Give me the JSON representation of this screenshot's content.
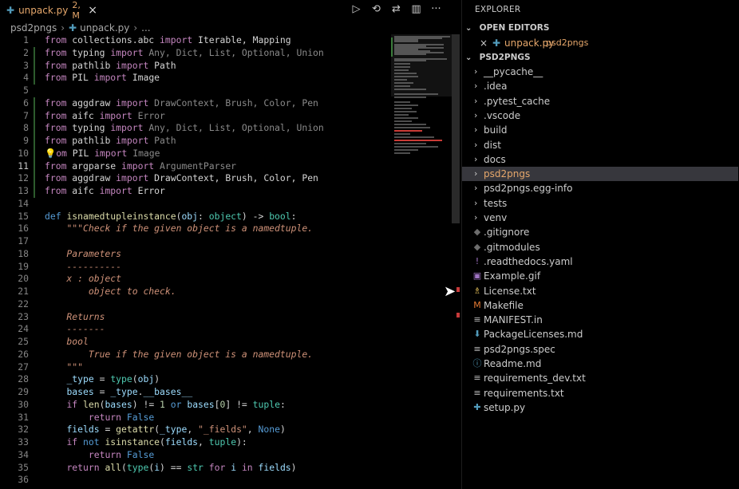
{
  "tab": {
    "filename": "unpack.py",
    "status": "2, M",
    "close": "×"
  },
  "toolbar": {
    "run": "▷",
    "history": "⟲",
    "compare": "⇄",
    "split": "▥",
    "more": "···"
  },
  "breadcrumb": {
    "folder": "psd2pngs",
    "file": "unpack.py",
    "symbol": "..."
  },
  "code_lines": [
    {
      "n": "1",
      "segs": [
        [
          "kw",
          "from"
        ],
        [
          "plain",
          " collections.abc "
        ],
        [
          "kw",
          "import"
        ],
        [
          "plain",
          " Iterable, Mapping"
        ]
      ]
    },
    {
      "n": "2",
      "segs": [
        [
          "kw",
          "from"
        ],
        [
          "plain",
          " typing "
        ],
        [
          "kw",
          "import"
        ],
        [
          "dim",
          " Any, Dict, List, Optional, Union"
        ]
      ]
    },
    {
      "n": "3",
      "segs": [
        [
          "kw",
          "from"
        ],
        [
          "plain",
          " pathlib "
        ],
        [
          "kw",
          "import"
        ],
        [
          "plain",
          " Path"
        ]
      ]
    },
    {
      "n": "4",
      "segs": [
        [
          "kw",
          "from"
        ],
        [
          "plain",
          " PIL "
        ],
        [
          "kw",
          "import"
        ],
        [
          "plain",
          " Image"
        ]
      ]
    },
    {
      "n": "5",
      "segs": []
    },
    {
      "n": "6",
      "segs": [
        [
          "kw",
          "from"
        ],
        [
          "plain",
          " aggdraw "
        ],
        [
          "kw",
          "import"
        ],
        [
          "dim",
          " DrawContext, Brush, Color, Pen"
        ]
      ]
    },
    {
      "n": "7",
      "segs": [
        [
          "kw",
          "from"
        ],
        [
          "plain",
          " aifc "
        ],
        [
          "kw",
          "import"
        ],
        [
          "dim",
          " Error"
        ]
      ]
    },
    {
      "n": "8",
      "segs": [
        [
          "kw",
          "from"
        ],
        [
          "plain",
          " typing "
        ],
        [
          "kw",
          "import"
        ],
        [
          "dim",
          " Any, Dict, List, Optional, Union"
        ]
      ]
    },
    {
      "n": "9",
      "segs": [
        [
          "kw",
          "from"
        ],
        [
          "plain",
          " pathlib "
        ],
        [
          "kw",
          "import"
        ],
        [
          "dim",
          " Path"
        ]
      ]
    },
    {
      "n": "10",
      "segs": [
        [
          "bulb",
          "💡"
        ],
        [
          "kw",
          "om"
        ],
        [
          "plain",
          " PIL "
        ],
        [
          "kw",
          "import"
        ],
        [
          "dim",
          " Image"
        ]
      ]
    },
    {
      "n": "11",
      "segs": [
        [
          "kw",
          "from"
        ],
        [
          "plain",
          " argparse "
        ],
        [
          "kw",
          "import"
        ],
        [
          "dim",
          " ArgumentParser"
        ]
      ]
    },
    {
      "n": "12",
      "segs": [
        [
          "kw",
          "from"
        ],
        [
          "plain",
          " aggdraw "
        ],
        [
          "kw",
          "import"
        ],
        [
          "plain",
          " DrawContext, Brush, Color, Pen"
        ]
      ]
    },
    {
      "n": "13",
      "segs": [
        [
          "kw",
          "from"
        ],
        [
          "plain",
          " aifc "
        ],
        [
          "kw",
          "import"
        ],
        [
          "plain",
          " Error"
        ]
      ]
    },
    {
      "n": "14",
      "segs": []
    },
    {
      "n": "15",
      "segs": [
        [
          "kw2",
          "def"
        ],
        [
          "plain",
          " "
        ],
        [
          "fn",
          "isnamedtupleinstance"
        ],
        [
          "plain",
          "("
        ],
        [
          "var",
          "obj"
        ],
        [
          "plain",
          ": "
        ],
        [
          "ty",
          "object"
        ],
        [
          "plain",
          ") -> "
        ],
        [
          "ty",
          "bool"
        ],
        [
          "plain",
          ":"
        ]
      ]
    },
    {
      "n": "16",
      "segs": [
        [
          "plain",
          "    "
        ],
        [
          "doc",
          "\"\"\"Check if the given object is a namedtuple."
        ]
      ]
    },
    {
      "n": "17",
      "segs": []
    },
    {
      "n": "18",
      "segs": [
        [
          "doc",
          "    Parameters"
        ]
      ]
    },
    {
      "n": "19",
      "segs": [
        [
          "doc",
          "    ----------"
        ]
      ]
    },
    {
      "n": "20",
      "segs": [
        [
          "doc",
          "    x : object"
        ]
      ]
    },
    {
      "n": "21",
      "segs": [
        [
          "doc",
          "        object to check."
        ]
      ]
    },
    {
      "n": "22",
      "segs": []
    },
    {
      "n": "23",
      "segs": [
        [
          "doc",
          "    Returns"
        ]
      ]
    },
    {
      "n": "24",
      "segs": [
        [
          "doc",
          "    -------"
        ]
      ]
    },
    {
      "n": "25",
      "segs": [
        [
          "doc",
          "    bool"
        ]
      ]
    },
    {
      "n": "26",
      "segs": [
        [
          "doc",
          "        True if the given object is a namedtuple."
        ]
      ]
    },
    {
      "n": "27",
      "segs": [
        [
          "doc",
          "    \"\"\""
        ]
      ]
    },
    {
      "n": "28",
      "segs": [
        [
          "plain",
          "    "
        ],
        [
          "var",
          "_type"
        ],
        [
          "plain",
          " = "
        ],
        [
          "ty",
          "type"
        ],
        [
          "plain",
          "("
        ],
        [
          "var",
          "obj"
        ],
        [
          "plain",
          ")"
        ]
      ]
    },
    {
      "n": "29",
      "segs": [
        [
          "plain",
          "    "
        ],
        [
          "var",
          "bases"
        ],
        [
          "plain",
          " = "
        ],
        [
          "var",
          "_type"
        ],
        [
          "plain",
          "."
        ],
        [
          "var",
          "__bases__"
        ]
      ]
    },
    {
      "n": "30",
      "segs": [
        [
          "plain",
          "    "
        ],
        [
          "kw",
          "if"
        ],
        [
          "plain",
          " "
        ],
        [
          "fn",
          "len"
        ],
        [
          "plain",
          "("
        ],
        [
          "var",
          "bases"
        ],
        [
          "plain",
          ") != "
        ],
        [
          "num",
          "1"
        ],
        [
          "plain",
          " "
        ],
        [
          "kw2",
          "or"
        ],
        [
          "plain",
          " "
        ],
        [
          "var",
          "bases"
        ],
        [
          "plain",
          "["
        ],
        [
          "num",
          "0"
        ],
        [
          "plain",
          "] != "
        ],
        [
          "ty",
          "tuple"
        ],
        [
          "plain",
          ":"
        ]
      ]
    },
    {
      "n": "31",
      "segs": [
        [
          "plain",
          "        "
        ],
        [
          "kw",
          "return"
        ],
        [
          "plain",
          " "
        ],
        [
          "kw2",
          "False"
        ]
      ]
    },
    {
      "n": "32",
      "segs": [
        [
          "plain",
          "    "
        ],
        [
          "var",
          "fields"
        ],
        [
          "plain",
          " = "
        ],
        [
          "fn",
          "getattr"
        ],
        [
          "plain",
          "("
        ],
        [
          "var",
          "_type"
        ],
        [
          "plain",
          ", "
        ],
        [
          "str",
          "\"_fields\""
        ],
        [
          "plain",
          ", "
        ],
        [
          "kw2",
          "None"
        ],
        [
          "plain",
          ")"
        ]
      ]
    },
    {
      "n": "33",
      "segs": [
        [
          "plain",
          "    "
        ],
        [
          "kw",
          "if"
        ],
        [
          "plain",
          " "
        ],
        [
          "kw2",
          "not"
        ],
        [
          "plain",
          " "
        ],
        [
          "fn",
          "isinstance"
        ],
        [
          "plain",
          "("
        ],
        [
          "var",
          "fields"
        ],
        [
          "plain",
          ", "
        ],
        [
          "ty",
          "tuple"
        ],
        [
          "plain",
          "):"
        ]
      ]
    },
    {
      "n": "34",
      "segs": [
        [
          "plain",
          "        "
        ],
        [
          "kw",
          "return"
        ],
        [
          "plain",
          " "
        ],
        [
          "kw2",
          "False"
        ]
      ]
    },
    {
      "n": "35",
      "segs": [
        [
          "plain",
          "    "
        ],
        [
          "kw",
          "return"
        ],
        [
          "plain",
          " "
        ],
        [
          "fn",
          "all"
        ],
        [
          "plain",
          "("
        ],
        [
          "ty",
          "type"
        ],
        [
          "plain",
          "("
        ],
        [
          "var",
          "i"
        ],
        [
          "plain",
          ") == "
        ],
        [
          "ty",
          "str"
        ],
        [
          "plain",
          " "
        ],
        [
          "kw",
          "for"
        ],
        [
          "plain",
          " "
        ],
        [
          "var",
          "i"
        ],
        [
          "plain",
          " "
        ],
        [
          "kw",
          "in"
        ],
        [
          "plain",
          " "
        ],
        [
          "var",
          "fields"
        ],
        [
          "plain",
          ")"
        ]
      ]
    },
    {
      "n": "36",
      "segs": []
    }
  ],
  "explorer": {
    "title": "EXPLORER",
    "open_editors_header": "OPEN EDITORS",
    "open_editor": {
      "close": "×",
      "name": "unpack.py",
      "desc": "psd2pngs"
    },
    "project_header": "PSD2PNGS",
    "tree": [
      {
        "type": "folder",
        "label": "__pycache__",
        "icon": "chevron-right-icon"
      },
      {
        "type": "folder",
        "label": ".idea",
        "icon": "chevron-right-icon"
      },
      {
        "type": "folder",
        "label": ".pytest_cache",
        "icon": "chevron-right-icon"
      },
      {
        "type": "folder",
        "label": ".vscode",
        "icon": "chevron-right-icon"
      },
      {
        "type": "folder",
        "label": "build",
        "icon": "chevron-right-icon"
      },
      {
        "type": "folder",
        "label": "dist",
        "icon": "chevron-right-icon"
      },
      {
        "type": "folder",
        "label": "docs",
        "icon": "chevron-right-icon"
      },
      {
        "type": "folder",
        "label": "psd2pngs",
        "icon": "chevron-right-icon",
        "selected": true
      },
      {
        "type": "folder",
        "label": "psd2pngs.egg-info",
        "icon": "chevron-right-icon"
      },
      {
        "type": "folder",
        "label": "tests",
        "icon": "chevron-right-icon"
      },
      {
        "type": "folder",
        "label": "venv",
        "icon": "chevron-right-icon"
      },
      {
        "type": "file",
        "label": ".gitignore",
        "icon": "git-icon",
        "glyph": "◆",
        "color": "#6d6d6d"
      },
      {
        "type": "file",
        "label": ".gitmodules",
        "icon": "git-icon",
        "glyph": "◆",
        "color": "#6d6d6d"
      },
      {
        "type": "file",
        "label": ".readthedocs.yaml",
        "icon": "exclamation-icon",
        "glyph": "!",
        "color": "#a074c4"
      },
      {
        "type": "file",
        "label": "Example.gif",
        "icon": "image-icon",
        "glyph": "▣",
        "color": "#a074c4"
      },
      {
        "type": "file",
        "label": "License.txt",
        "icon": "license-icon",
        "glyph": "♗",
        "color": "#e6c15a"
      },
      {
        "type": "file",
        "label": "Makefile",
        "icon": "makefile-icon",
        "glyph": "M",
        "color": "#e37933"
      },
      {
        "type": "file",
        "label": "MANIFEST.in",
        "icon": "text-file-icon",
        "glyph": "≡",
        "color": "#bbb"
      },
      {
        "type": "file",
        "label": "PackageLicenses.md",
        "icon": "download-icon",
        "glyph": "⬇",
        "color": "#519aba"
      },
      {
        "type": "file",
        "label": "psd2pngs.spec",
        "icon": "text-file-icon",
        "glyph": "≡",
        "color": "#bbb"
      },
      {
        "type": "file",
        "label": "Readme.md",
        "icon": "info-icon",
        "glyph": "ⓘ",
        "color": "#519aba"
      },
      {
        "type": "file",
        "label": "requirements_dev.txt",
        "icon": "text-file-icon",
        "glyph": "≡",
        "color": "#bbb"
      },
      {
        "type": "file",
        "label": "requirements.txt",
        "icon": "text-file-icon",
        "glyph": "≡",
        "color": "#bbb"
      },
      {
        "type": "file",
        "label": "setup.py",
        "icon": "python-icon",
        "glyph": "✚",
        "color": "#519aba"
      }
    ]
  }
}
